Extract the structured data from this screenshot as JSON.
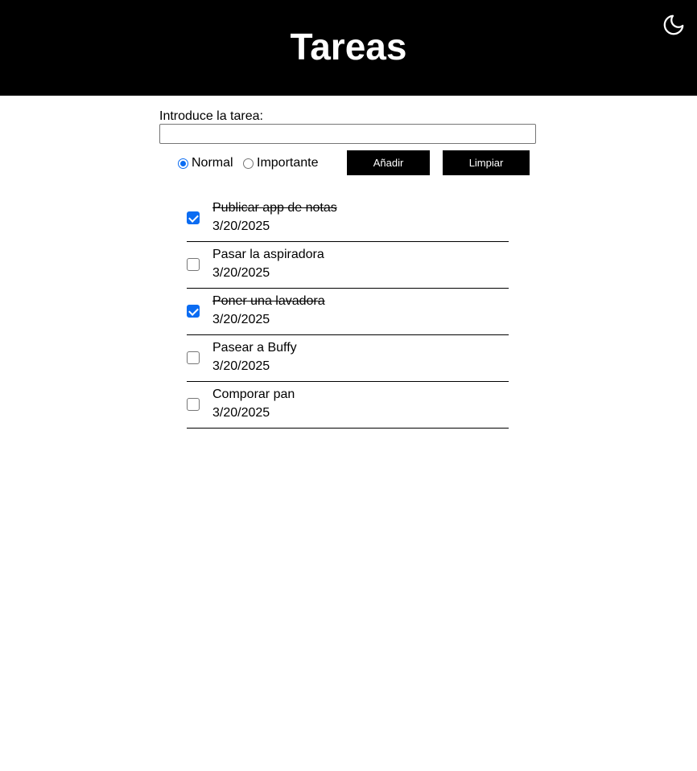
{
  "header": {
    "title": "Tareas",
    "theme_icon": "moon-icon"
  },
  "form": {
    "label": "Introduce la tarea:",
    "input_value": "",
    "radio_normal": "Normal",
    "radio_important": "Importante",
    "selected_priority": "Normal",
    "add_label": "Añadir",
    "clear_label": "Limpiar"
  },
  "colors": {
    "accent": "#0b6cf2",
    "header_bg": "#000000",
    "button_bg": "#000000"
  },
  "tasks": [
    {
      "name": "Publicar app de notas",
      "date": "3/20/2025",
      "done": true
    },
    {
      "name": "Pasar la aspiradora",
      "date": "3/20/2025",
      "done": false
    },
    {
      "name": "Poner una lavadora",
      "date": "3/20/2025",
      "done": true
    },
    {
      "name": "Pasear a Buffy",
      "date": "3/20/2025",
      "done": false
    },
    {
      "name": "Comporar pan",
      "date": "3/20/2025",
      "done": false
    }
  ]
}
